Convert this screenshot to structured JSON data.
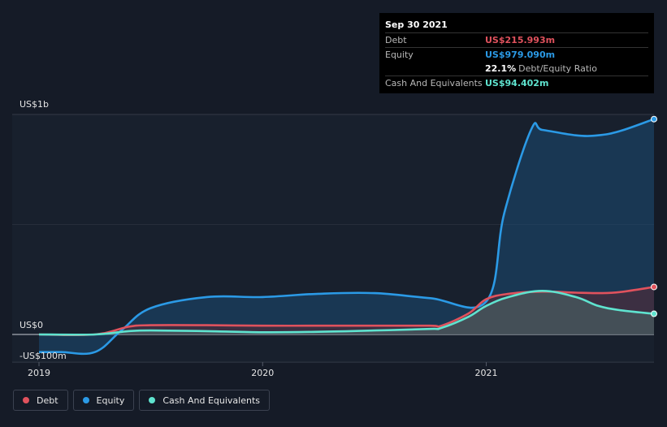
{
  "tooltip": {
    "date": "Sep 30 2021",
    "rows": [
      {
        "label": "Debt",
        "value": "US$215.993m",
        "color": "#e0525d"
      },
      {
        "label": "Equity",
        "value": "US$979.090m",
        "color": "#2b9ae6"
      },
      {
        "label": "",
        "value": "22.1%",
        "extra": "Debt/Equity Ratio",
        "color": "#ffffff"
      },
      {
        "label": "Cash And Equivalents",
        "value": "US$94.402m",
        "color": "#5fe3cf"
      }
    ]
  },
  "legend": [
    {
      "label": "Debt",
      "color": "#e0525d"
    },
    {
      "label": "Equity",
      "color": "#2b9ae6"
    },
    {
      "label": "Cash And Equivalents",
      "color": "#5fe3cf"
    }
  ],
  "chart_data": {
    "type": "area",
    "y_tick_labels": [
      "US$1b",
      "US$0",
      "-US$100m"
    ],
    "x_tick_labels": [
      "2019",
      "2020",
      "2021"
    ],
    "ylim": [
      -100,
      1000
    ],
    "xlim": [
      2019.0,
      2021.75
    ],
    "grid": true,
    "series": [
      {
        "name": "Debt",
        "color": "#e0525d",
        "x": [
          2019.0,
          2019.25,
          2019.4,
          2019.5,
          2019.75,
          2020.0,
          2020.25,
          2020.5,
          2020.75,
          2020.8,
          2020.92,
          2021.0,
          2021.1,
          2021.25,
          2021.4,
          2021.5,
          2021.6,
          2021.75
        ],
        "y": [
          0,
          0,
          35,
          42,
          42,
          40,
          40,
          40,
          40,
          40,
          95,
          160,
          185,
          195,
          190,
          188,
          193,
          216
        ]
      },
      {
        "name": "Equity",
        "color": "#2b9ae6",
        "x": [
          2019.0,
          2019.1,
          2019.25,
          2019.37,
          2019.5,
          2019.75,
          2020.0,
          2020.25,
          2020.5,
          2020.75,
          2021.0,
          2021.08,
          2021.2,
          2021.25,
          2021.4,
          2021.5,
          2021.6,
          2021.75
        ],
        "y": [
          -80,
          -80,
          -80,
          20,
          120,
          170,
          170,
          185,
          188,
          165,
          150,
          550,
          930,
          930,
          905,
          905,
          925,
          979
        ]
      },
      {
        "name": "Cash And Equivalents",
        "color": "#5fe3cf",
        "x": [
          2019.0,
          2019.25,
          2019.4,
          2019.5,
          2019.75,
          2020.0,
          2020.25,
          2020.5,
          2020.75,
          2020.8,
          2020.92,
          2021.0,
          2021.1,
          2021.25,
          2021.4,
          2021.5,
          2021.6,
          2021.75
        ],
        "y": [
          0,
          0,
          15,
          18,
          15,
          10,
          12,
          18,
          25,
          30,
          80,
          130,
          170,
          198,
          170,
          130,
          110,
          94
        ]
      }
    ]
  }
}
